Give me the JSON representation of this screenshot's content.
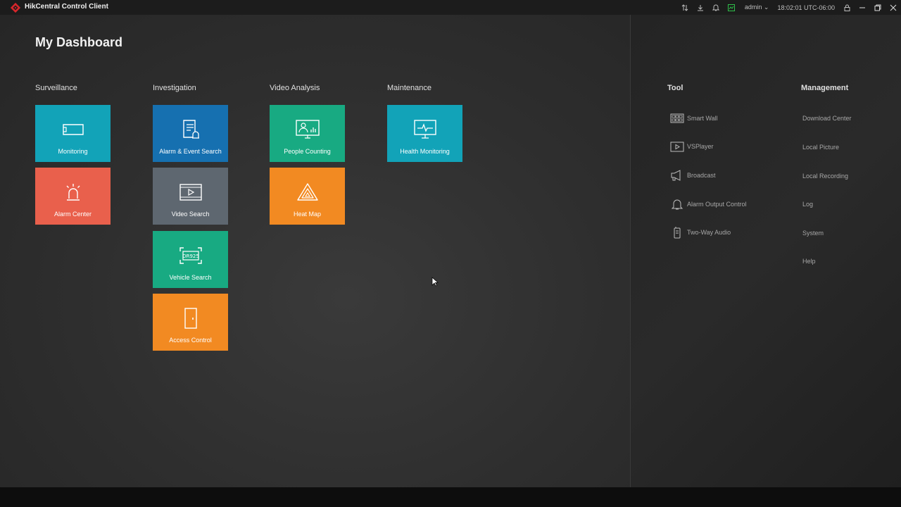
{
  "window": {
    "title": "HikCentral Control Client",
    "user": "admin",
    "time": "18:02:01 UTC-06:00"
  },
  "page_title": "My Dashboard",
  "categories": {
    "surveillance": "Surveillance",
    "investigation": "Investigation",
    "video_analysis": "Video Analysis",
    "maintenance": "Maintenance"
  },
  "tiles": {
    "monitoring": "Monitoring",
    "alarm_center": "Alarm Center",
    "alarm_event_search": "Alarm & Event Search",
    "video_search": "Video Search",
    "vehicle_search": "Vehicle Search",
    "access_control": "Access Control",
    "people_counting": "People Counting",
    "heat_map": "Heat Map",
    "health_monitoring": "Health Monitoring"
  },
  "tool": {
    "title": "Tool",
    "items": [
      "Smart Wall",
      "VSPlayer",
      "Broadcast",
      "Alarm Output Control",
      "Two-Way Audio"
    ]
  },
  "management": {
    "title": "Management",
    "items": [
      "Download Center",
      "Local Picture",
      "Local Recording",
      "Log",
      "System",
      "Help"
    ]
  },
  "colors": {
    "teal": "#12a3b8",
    "red": "#e9604c",
    "blue": "#1670b0",
    "gray": "#5e6770",
    "green": "#18aa82",
    "orange": "#f28a22",
    "brand": "#d8262b"
  },
  "icons": {
    "logo": "hikvision-diamond-logo",
    "titlebar": [
      "sort-arrows-icon",
      "download-icon",
      "bell-icon",
      "resource-status-icon",
      "lock-icon",
      "minimize-icon",
      "restore-icon",
      "close-icon"
    ]
  }
}
